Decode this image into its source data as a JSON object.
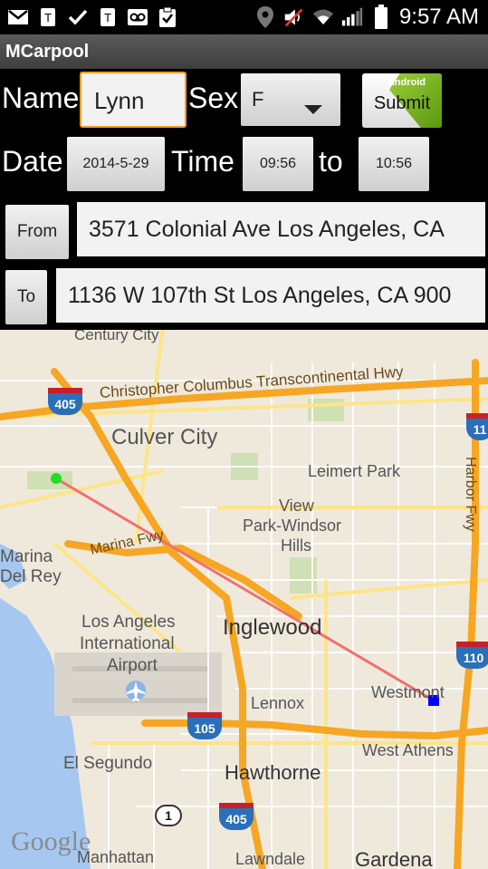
{
  "status_bar": {
    "time": "9:57 AM",
    "icons": [
      "mail-icon",
      "tmobile-icon",
      "check-icon",
      "tmobile-icon",
      "voicemail-icon",
      "clipboard-check-icon",
      "location-icon",
      "mute-icon",
      "wifi-icon",
      "signal-icon",
      "battery-icon"
    ]
  },
  "app": {
    "title": "MCarpool"
  },
  "form": {
    "name_label": "Name",
    "name_value": "Lynn",
    "sex_label": "Sex",
    "sex_value": "F",
    "submit_label": "Submit",
    "submit_badge": "Android",
    "date_label": "Date",
    "date_value": "2014-5-29",
    "time_label": "Time",
    "time_from": "09:56",
    "to_label": "to",
    "time_to": "10:56",
    "from_button": "From",
    "from_address": "3571 Colonial Ave Los Angeles, CA",
    "to_button": "To",
    "to_address": "1136 W 107th St Los Angeles, CA 900",
    "accent_color": "#f59a23"
  },
  "map": {
    "labels": {
      "century_city": "Century City",
      "christopher": "Christopher Columbus Transcontinental Hwy",
      "culver_city": "Culver City",
      "leimert_park": "Leimert Park",
      "harbor_fwy": "Harbor Fwy",
      "view_park_1": "View",
      "view_park_2": "Park-Windsor",
      "view_park_3": "Hills",
      "marina_1": "Marina",
      "marina_2": "Del Rey",
      "marina_fwy": "Marina Fwy",
      "lax_1": "Los Angeles",
      "lax_2": "International",
      "lax_3": "Airport",
      "inglewood": "Inglewood",
      "lennox": "Lennox",
      "westmont": "Westmont",
      "west_athens": "West Athens",
      "el_segundo": "El Segundo",
      "hawthorne": "Hawthorne",
      "manhattan": "Manhattan",
      "lawndale": "Lawndale",
      "gardena": "Gardena",
      "google": "Google"
    },
    "shields": {
      "i405_top": "405",
      "i110_top": "11",
      "i110_mid": "110",
      "i105": "105",
      "i405_bottom": "405",
      "ca1": "1"
    },
    "route_color": "#f07070",
    "start_marker_color": "#22dd22",
    "end_marker_color": "#0000ff"
  }
}
